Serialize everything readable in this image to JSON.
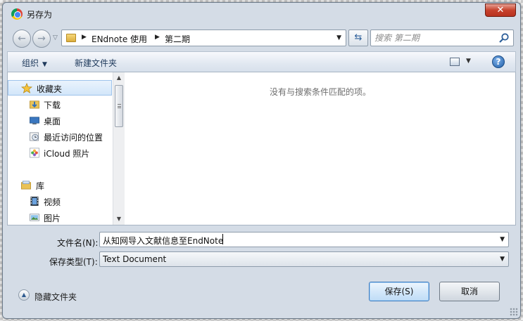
{
  "window": {
    "title": "另存为"
  },
  "address": {
    "crumbs": [
      "ENdnote 使用",
      "第二期"
    ]
  },
  "search": {
    "placeholder": "搜索 第二期"
  },
  "toolbar": {
    "organize_label": "组织",
    "new_folder_label": "新建文件夹"
  },
  "nav": {
    "items": [
      {
        "label": "收藏夹",
        "icon": "star-icon"
      },
      {
        "label": "下载",
        "icon": "download-folder-icon"
      },
      {
        "label": "桌面",
        "icon": "desktop-icon"
      },
      {
        "label": "最近访问的位置",
        "icon": "recent-places-icon"
      },
      {
        "label": "iCloud 照片",
        "icon": "icloud-photos-icon"
      },
      {
        "label": "库",
        "icon": "library-icon"
      },
      {
        "label": "视频",
        "icon": "videos-icon"
      },
      {
        "label": "图片",
        "icon": "pictures-icon"
      }
    ]
  },
  "file_area": {
    "empty_message": "没有与搜索条件匹配的项。"
  },
  "form": {
    "filename_label": "文件名(N):",
    "filename_value": "从知网导入文献信息至EndNote",
    "filetype_label": "保存类型(T):",
    "filetype_value": "Text Document"
  },
  "footer": {
    "hide_folders_label": "隐藏文件夹",
    "save_label": "保存(S)",
    "cancel_label": "取消"
  },
  "colors": {
    "accent": "#3d7bbf",
    "link": "#1e395b",
    "close": "#c7422d"
  }
}
